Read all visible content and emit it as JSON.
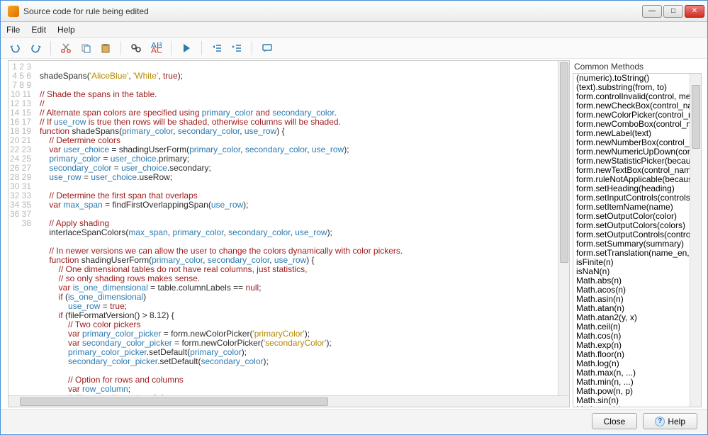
{
  "window": {
    "title": "Source code for rule being edited"
  },
  "menu": [
    "File",
    "Edit",
    "Help"
  ],
  "toolbar_icons": [
    "undo-icon",
    "redo-icon",
    "|",
    "cut-icon",
    "copy-icon",
    "paste-icon",
    "|",
    "find-icon",
    "find-replace-icon",
    "|",
    "run-icon",
    "|",
    "outdent-icon",
    "indent-icon",
    "|",
    "comment-icon"
  ],
  "editor": {
    "lines": [
      "",
      "shadeSpans('AliceBlue', 'White', true);",
      "",
      "// Shade the spans in the table.",
      "//",
      "// Alternate span colors are specified using primary_color and secondary_color.",
      "// If use_row is true then rows will be shaded, otherwise columns will be shaded.",
      "function shadeSpans(primary_color, secondary_color, use_row) {",
      "    // Determine colors",
      "    var user_choice = shadingUserForm(primary_color, secondary_color, use_row);",
      "    primary_color = user_choice.primary;",
      "    secondary_color = user_choice.secondary;",
      "    use_row = user_choice.useRow;",
      "",
      "    // Determine the first span that overlaps",
      "    var max_span = findFirstOverlappingSpan(use_row);",
      "",
      "    // Apply shading",
      "    interlaceSpanColors(max_span, primary_color, secondary_color, use_row);",
      "",
      "    // In newer versions we can allow the user to change the colors dynamically with color pickers.",
      "    function shadingUserForm(primary_color, secondary_color, use_row) {",
      "        // One dimensional tables do not have real columns, just statistics,",
      "        // so only shading rows makes sense.",
      "        var is_one_dimensional = table.columnLabels == null;",
      "        if (is_one_dimensional)",
      "            use_row = true;",
      "        if (fileFormatVersion() > 8.12) {",
      "            // Two color pickers",
      "            var primary_color_picker = form.newColorPicker('primaryColor');",
      "            var secondary_color_picker = form.newColorPicker('secondaryColor');",
      "            primary_color_picker.setDefault(primary_color);",
      "            secondary_color_picker.setDefault(secondary_color);",
      "",
      "            // Option for rows and columns",
      "            var row_column;",
      "            if (!is_one_dimensional) {"
    ]
  },
  "side_panel": {
    "heading": "Common Methods",
    "items": [
      "(numeric).toString()",
      "(text).substring(from, to)",
      "form.controlInvalid(control, message)",
      "form.newCheckBox(control_name)",
      "form.newColorPicker(control_name)",
      "form.newComboBox(control_name)",
      "form.newLabel(text)",
      "form.newNumberBox(control_name)",
      "form.newNumericUpDown(control_name)",
      "form.newStatisticPicker(because)",
      "form.newTextBox(control_name)",
      "form.ruleNotApplicable(because)",
      "form.setHeading(heading)",
      "form.setInputControls(controls)",
      "form.setItemName(name)",
      "form.setOutputColor(color)",
      "form.setOutputColors(colors)",
      "form.setOutputControls(controls)",
      "form.setSummary(summary)",
      "form.setTranslation(name_en, name)",
      "isFinite(n)",
      "isNaN(n)",
      "Math.abs(n)",
      "Math.acos(n)",
      "Math.asin(n)",
      "Math.atan(n)",
      "Math.atan2(y, x)",
      "Math.ceil(n)",
      "Math.cos(n)",
      "Math.exp(n)",
      "Math.floor(n)",
      "Math.log(n)",
      "Math.max(n, ...)",
      "Math.min(n, ...)",
      "Math.pow(n, p)",
      "Math.sin(n)",
      "Math.sqrt(n)"
    ]
  },
  "buttons": {
    "close": "Close",
    "help": "Help"
  }
}
